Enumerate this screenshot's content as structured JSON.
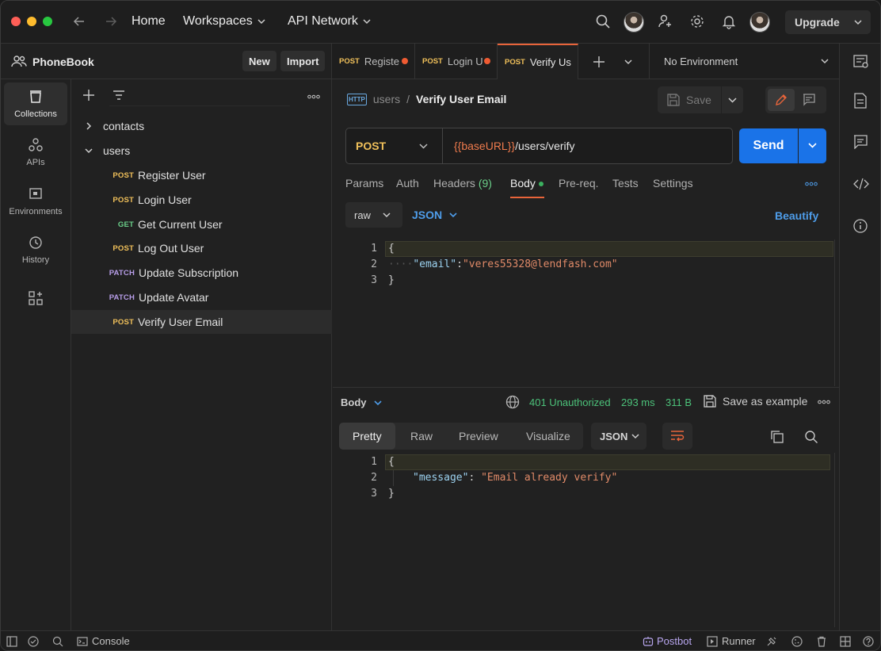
{
  "app": {
    "nav": {
      "home": "Home",
      "workspaces": "Workspaces",
      "api_network": "API Network"
    },
    "upgrade_label": "Upgrade",
    "accent": "#e8643a",
    "send_color": "#1a73e8"
  },
  "workspace": {
    "name": "PhoneBook",
    "new_label": "New",
    "import_label": "Import"
  },
  "rail": {
    "collections": "Collections",
    "apis": "APIs",
    "environments": "Environments",
    "history": "History"
  },
  "tree": {
    "folders": [
      {
        "label": "contacts"
      },
      {
        "label": "users"
      }
    ],
    "requests": [
      {
        "method": "POST",
        "label": "Register User"
      },
      {
        "method": "POST",
        "label": "Login User"
      },
      {
        "method": "GET",
        "label": "Get Current User"
      },
      {
        "method": "POST",
        "label": "Log Out User"
      },
      {
        "method": "PATCH",
        "label": "Update Subscription"
      },
      {
        "method": "PATCH",
        "label": "Update Avatar"
      },
      {
        "method": "POST",
        "label": "Verify User Email"
      }
    ]
  },
  "tabs": [
    {
      "method": "POST",
      "label": "Registe"
    },
    {
      "method": "POST",
      "label": "Login U"
    },
    {
      "method": "POST",
      "label": "Verify Us"
    }
  ],
  "environment": {
    "selected": "No Environment"
  },
  "request": {
    "breadcrumb_parent": "users",
    "breadcrumb_sep": "/",
    "name": "Verify User Email",
    "http_badge": "HTTP",
    "save_label": "Save",
    "method": "POST",
    "url_var": "{{baseURL}}",
    "url_path": "/users/verify",
    "send_label": "Send",
    "tabs": {
      "params": "Params",
      "auth": "Auth",
      "headers": "Headers",
      "headers_count": "(9)",
      "body": "Body",
      "prereq": "Pre-req.",
      "tests": "Tests",
      "settings": "Settings"
    },
    "body_mode": "raw",
    "body_lang": "JSON",
    "beautify_label": "Beautify",
    "body_lines": {
      "n1": "1",
      "n2": "2",
      "n3": "3",
      "open": "{",
      "key": "\"email\"",
      "colon": ":",
      "value": "\"veres55328@lendfash.com\"",
      "close": "}"
    }
  },
  "response": {
    "label": "Body",
    "status": "401 Unauthorized",
    "time": "293 ms",
    "size": "311 B",
    "save_example": "Save as example",
    "view_tabs": {
      "pretty": "Pretty",
      "raw": "Raw",
      "preview": "Preview",
      "visualize": "Visualize"
    },
    "format": "JSON",
    "lines": {
      "n1": "1",
      "n2": "2",
      "n3": "3",
      "open": "{",
      "key": "\"message\"",
      "colon": ": ",
      "value": "\"Email already verify\"",
      "close": "}"
    }
  },
  "statusbar": {
    "console": "Console",
    "postbot": "Postbot",
    "runner": "Runner"
  }
}
